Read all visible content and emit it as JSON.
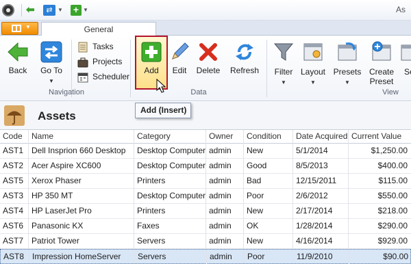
{
  "window": {
    "title": "As"
  },
  "ribbon": {
    "tab_general": "General",
    "buttons": {
      "back": "Back",
      "go_to": "Go To",
      "add": "Add",
      "edit": "Edit",
      "delete": "Delete",
      "refresh": "Refresh",
      "filter": "Filter",
      "layout": "Layout",
      "presets": "Presets",
      "create_preset_line1": "Create",
      "create_preset_line2": "Preset",
      "more": "Se"
    },
    "small_items": {
      "tasks": "Tasks",
      "projects": "Projects",
      "scheduler": "Scheduler"
    },
    "groups": {
      "navigation": "Navigation",
      "data": "Data",
      "view": "View"
    }
  },
  "tooltip": {
    "text": "Add (Insert)"
  },
  "page": {
    "title": "Assets"
  },
  "grid": {
    "headers": {
      "code": "Code",
      "name": "Name",
      "category": "Category",
      "owner": "Owner",
      "condition": "Condition",
      "date_acquired": "Date Acquired",
      "current_value": "Current Value"
    },
    "rows": [
      {
        "code": "AST1",
        "name": "Dell Insprion 660 Desktop",
        "category": "Desktop Computers",
        "owner": "admin",
        "condition": "New",
        "date": "5/1/2014",
        "value": "$1,250.00"
      },
      {
        "code": "AST2",
        "name": "Acer Aspire XC600",
        "category": "Desktop Computers",
        "owner": "admin",
        "condition": "Good",
        "date": "8/5/2013",
        "value": "$400.00"
      },
      {
        "code": "AST5",
        "name": "Xerox Phaser",
        "category": "Printers",
        "owner": "admin",
        "condition": "Bad",
        "date": "12/15/2011",
        "value": "$115.00"
      },
      {
        "code": "AST3",
        "name": "HP 350 MT",
        "category": "Desktop Computers",
        "owner": "admin",
        "condition": "Poor",
        "date": "2/6/2012",
        "value": "$550.00"
      },
      {
        "code": "AST4",
        "name": "HP LaserJet Pro",
        "category": "Printers",
        "owner": "admin",
        "condition": "New",
        "date": "2/17/2014",
        "value": "$218.00"
      },
      {
        "code": "AST6",
        "name": "Panasonic KX",
        "category": "Faxes",
        "owner": "admin",
        "condition": "OK",
        "date": "1/28/2014",
        "value": "$290.00"
      },
      {
        "code": "AST7",
        "name": "Patriot Tower",
        "category": "Servers",
        "owner": "admin",
        "condition": "New",
        "date": "4/16/2014",
        "value": "$929.00"
      },
      {
        "code": "AST8",
        "name": "Impression HomeServer",
        "category": "Servers",
        "owner": "admin",
        "condition": "Poor",
        "date": "11/9/2010",
        "value": "$90.00"
      }
    ],
    "selected_row": "AST8"
  },
  "colors": {
    "accent_orange": "#f08c00",
    "highlight_border": "#b2142d",
    "selected_row": "#d8e6f6"
  }
}
